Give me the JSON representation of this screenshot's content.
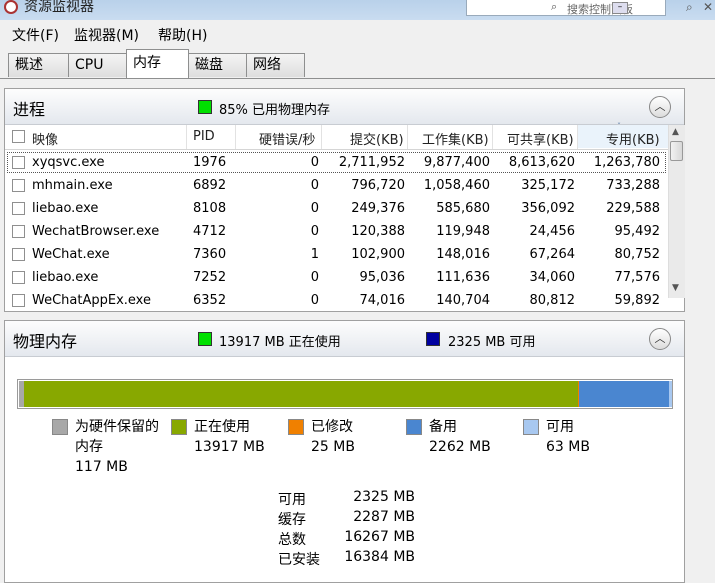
{
  "window": {
    "title": "资源监视器",
    "search_placeholder": "搜索控制面板"
  },
  "menu": [
    "文件(F)",
    "监视器(M)",
    "帮助(H)"
  ],
  "tabs": [
    "概述",
    "CPU",
    "内存",
    "磁盘",
    "网络"
  ],
  "active_tab": "内存",
  "process_section": {
    "title": "进程",
    "summary": "85% 已用物理内存",
    "summary_color": "#00e000",
    "columns": [
      "映像",
      "PID",
      "硬错误/秒",
      "提交(KB)",
      "工作集(KB)",
      "可共享(KB)",
      "专用(KB)"
    ],
    "sort_column": "专用(KB)",
    "rows": [
      {
        "image": "xyqsvc.exe",
        "pid": "1976",
        "hard_faults": "0",
        "commit": "2,711,952",
        "working_set": "9,877,400",
        "shareable": "8,613,620",
        "private": "1,263,780",
        "selected": true
      },
      {
        "image": "mhmain.exe",
        "pid": "6892",
        "hard_faults": "0",
        "commit": "796,720",
        "working_set": "1,058,460",
        "shareable": "325,172",
        "private": "733,288"
      },
      {
        "image": "liebao.exe",
        "pid": "8108",
        "hard_faults": "0",
        "commit": "249,376",
        "working_set": "585,680",
        "shareable": "356,092",
        "private": "229,588"
      },
      {
        "image": "WechatBrowser.exe",
        "pid": "4712",
        "hard_faults": "0",
        "commit": "120,388",
        "working_set": "119,948",
        "shareable": "24,456",
        "private": "95,492"
      },
      {
        "image": "WeChat.exe",
        "pid": "7360",
        "hard_faults": "1",
        "commit": "102,900",
        "working_set": "148,016",
        "shareable": "67,264",
        "private": "80,752"
      },
      {
        "image": "liebao.exe",
        "pid": "7252",
        "hard_faults": "0",
        "commit": "95,036",
        "working_set": "111,636",
        "shareable": "34,060",
        "private": "77,576"
      },
      {
        "image": "WeChatAppEx.exe",
        "pid": "6352",
        "hard_faults": "0",
        "commit": "74,016",
        "working_set": "140,704",
        "shareable": "80,812",
        "private": "59,892"
      }
    ]
  },
  "memory_section": {
    "title": "物理内存",
    "in_use_summary": "13917 MB 正在使用",
    "in_use_color": "#00e000",
    "available_summary": "2325 MB 可用",
    "available_color": "#0000a0",
    "bar_fractions": {
      "hardware_reserved": 0.007,
      "in_use": 0.85,
      "modified": 0.002,
      "standby": 0.138,
      "free": 0.004
    },
    "legend": [
      {
        "label": "为硬件保留的内存",
        "value": "117 MB",
        "color": "#a8a8a8"
      },
      {
        "label": "正在使用",
        "value": "13917 MB",
        "color": "#88a800"
      },
      {
        "label": "已修改",
        "value": "25 MB",
        "color": "#f08000"
      },
      {
        "label": "备用",
        "value": "2262 MB",
        "color": "#4a86d0"
      },
      {
        "label": "可用",
        "value": "63 MB",
        "color": "#a8c8f0"
      }
    ],
    "stats": [
      {
        "label": "可用",
        "value": "2325 MB"
      },
      {
        "label": "缓存",
        "value": "2287 MB"
      },
      {
        "label": "总数",
        "value": "16267 MB"
      },
      {
        "label": "已安装",
        "value": "16384 MB"
      }
    ]
  }
}
